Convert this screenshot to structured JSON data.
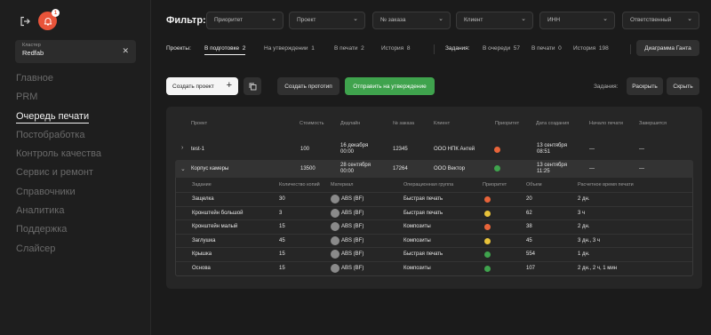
{
  "sidebar": {
    "notifications_count": "1",
    "cluster_label": "Кластер",
    "cluster_value": "Redfab",
    "nav": [
      "Главное",
      "PRM",
      "Очередь печати",
      "Постобработка",
      "Контроль качества",
      "Сервис и ремонт",
      "Справочники",
      "Аналитика",
      "Поддержка",
      "Слайсер"
    ],
    "active_nav": "Очередь печати"
  },
  "filter": {
    "title": "Фильтр:",
    "selects": [
      "Приоритет",
      "Проект",
      "№ заказа",
      "Клиент",
      "ИНН",
      "Ответственный"
    ]
  },
  "tabs": {
    "projects_label": "Проекты:",
    "projects": [
      {
        "label": "В подготовке",
        "count": "2"
      },
      {
        "label": "На утверждении",
        "count": "1"
      },
      {
        "label": "В печати",
        "count": "2"
      },
      {
        "label": "История",
        "count": "8"
      }
    ],
    "tasks_label": "Задания:",
    "tasks": [
      {
        "label": "В очереди",
        "count": "57"
      },
      {
        "label": "В печати",
        "count": "0"
      },
      {
        "label": "История",
        "count": "198"
      }
    ],
    "gantt_button": "Диаграмма Ганта"
  },
  "actions": {
    "create_project": "Создать проект",
    "create_prototype": "Создать прототип",
    "send_approval": "Отправить на утверждение",
    "tasks_label": "Задания:",
    "expand": "Раскрыть",
    "collapse": "Скрыть"
  },
  "table": {
    "headers": [
      "Проект",
      "Стоимость",
      "Дедлайн",
      "№ заказа",
      "Клиент",
      "Приоритет",
      "Дата создания",
      "Начало печати",
      "Завершится"
    ],
    "rows": [
      {
        "project": "test-1",
        "cost": "100",
        "deadline": "16 декабря",
        "deadline_time": "00:00",
        "order": "12345",
        "client": "ООО НПК Антей",
        "priority_color": "#e8643a",
        "created": "13 сентября",
        "created_time": "08:51",
        "start": "—",
        "end": "—"
      },
      {
        "project": "Корпус камеры",
        "cost": "13500",
        "deadline": "28 сентября",
        "deadline_time": "00:00",
        "order": "17264",
        "client": "ООО Вектор",
        "priority_color": "#3fa34d",
        "created": "13 сентября",
        "created_time": "11:25",
        "start": "—",
        "end": "—"
      }
    ]
  },
  "subtable": {
    "headers": [
      "Задание",
      "Количество копий",
      "Материал",
      "Операционная группа",
      "Приоритет",
      "Объем",
      "Расчетное время печати"
    ],
    "rows": [
      {
        "task": "Защелка",
        "copies": "30",
        "material": "ABS (BF)",
        "group": "Быстрая печать",
        "priority_color": "#e8643a",
        "volume": "20",
        "time": "2 дн."
      },
      {
        "task": "Кронштейн большой",
        "copies": "3",
        "material": "ABS (BF)",
        "group": "Быстрая печать",
        "priority_color": "#e8c23a",
        "volume": "62",
        "time": "3 ч"
      },
      {
        "task": "Кронштейн малый",
        "copies": "15",
        "material": "ABS (BF)",
        "group": "Композиты",
        "priority_color": "#e8643a",
        "volume": "38",
        "time": "2 дн."
      },
      {
        "task": "Заглушка",
        "copies": "45",
        "material": "ABS (BF)",
        "group": "Композиты",
        "priority_color": "#e8c23a",
        "volume": "45",
        "time": "3 дн., 3 ч"
      },
      {
        "task": "Крышка",
        "copies": "15",
        "material": "ABS (BF)",
        "group": "Быстрая печать",
        "priority_color": "#3fa34d",
        "volume": "554",
        "time": "1 дн."
      },
      {
        "task": "Основа",
        "copies": "15",
        "material": "ABS (BF)",
        "group": "Композиты",
        "priority_color": "#3fa34d",
        "volume": "107",
        "time": "2 дн., 2 ч, 1 мин"
      }
    ]
  }
}
